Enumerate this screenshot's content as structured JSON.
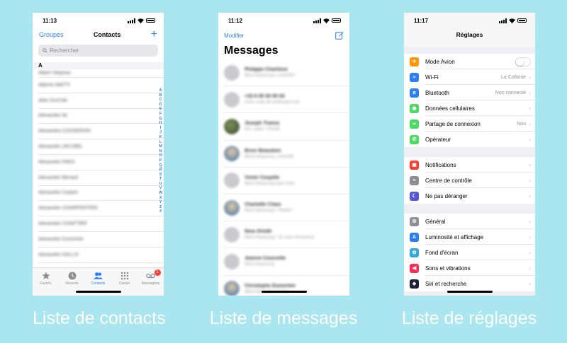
{
  "captions": [
    "Liste de contacts",
    "Liste de messages",
    "Liste de réglages"
  ],
  "contacts": {
    "time": "11:13",
    "groups": "Groupes",
    "title": "Contacts",
    "add": "+",
    "search_placeholder": "Rechercher",
    "section": "A",
    "rows": [
      "Albert Stephan",
      "Alberto MATTI",
      "Aldo DUCHA",
      "Alexandre Ali",
      "Alexandra COSSERON",
      "Alexandre JACOBS",
      "Alexandre FAES",
      "Alexandre Benard",
      "Alexandre Cadam",
      "Alexandre CHARPENTIER",
      "Alexandre CHAPTIER",
      "Alexandre Dumortier",
      "Alexandre GALLO"
    ],
    "index": [
      "A",
      "B",
      "C",
      "D",
      "E",
      "F",
      "G",
      "H",
      "I",
      "J",
      "K",
      "L",
      "M",
      "N",
      "O",
      "P",
      "Q",
      "R",
      "S",
      "T",
      "U",
      "V",
      "W",
      "X",
      "Y",
      "Z",
      "#"
    ],
    "tabs": [
      {
        "label": "Favoris",
        "icon": "star-icon"
      },
      {
        "label": "Récents",
        "icon": "clock-icon"
      },
      {
        "label": "Contacts",
        "icon": "contacts-icon"
      },
      {
        "label": "Clavier",
        "icon": "keypad-icon"
      },
      {
        "label": "Messagerie",
        "icon": "voicemail-icon"
      }
    ],
    "voicemail_badge": "1"
  },
  "messages": {
    "time": "11:12",
    "edit": "Modifier",
    "title": "Messages",
    "rows": [
      {
        "name": "Philippe Charlieux",
        "preview": "Merci beaucoup, à bientôt !"
      },
      {
        "name": "+33 6 00 00 00 00",
        "preview": "Votre code de vérification est"
      },
      {
        "name": "Joseph Tranca",
        "preview": "Oui, super ! Parfait"
      },
      {
        "name": "Brice Beaudoin",
        "preview": "Merci beaucoup, à bientôt"
      },
      {
        "name": "Victor Coujolle",
        "preview": "Merci beaucoup pour l'info"
      },
      {
        "name": "Charlotte Chaix",
        "preview": "Merci beaucoup ! Parfait !"
      },
      {
        "name": "Nina Orlotti",
        "preview": "Merci beaucoup ! Je vous recontacte"
      },
      {
        "name": "Jeanne Courcelle",
        "preview": "Merci beaucoup"
      },
      {
        "name": "Christophe Dumortier",
        "preview": "Merci beaucoup à vous"
      }
    ]
  },
  "settings": {
    "time": "11:17",
    "title": "Réglages",
    "groups": [
      [
        {
          "label": "Mode Avion",
          "color": "#ff9500",
          "icon": "airplane-icon",
          "glyph": "✈",
          "toggle": true
        },
        {
          "label": "Wi-Fi",
          "color": "#2b7ff2",
          "icon": "wifi-icon",
          "glyph": "≈",
          "value": "La Collonie"
        },
        {
          "label": "Bluetooth",
          "color": "#2b7ff2",
          "icon": "bluetooth-icon",
          "glyph": "ʙ",
          "value": "Non connecté"
        },
        {
          "label": "Données cellulaires",
          "color": "#4cd964",
          "icon": "cellular-icon",
          "glyph": "◉"
        },
        {
          "label": "Partage de connexion",
          "color": "#4cd964",
          "icon": "hotspot-icon",
          "glyph": "∞",
          "value": "Non"
        },
        {
          "label": "Opérateur",
          "color": "#4cd964",
          "icon": "phone-icon",
          "glyph": "✆"
        }
      ],
      [
        {
          "label": "Notifications",
          "color": "#ff3b30",
          "icon": "notifications-icon",
          "glyph": "▣"
        },
        {
          "label": "Centre de contrôle",
          "color": "#8e8e93",
          "icon": "control-center-icon",
          "glyph": "≡"
        },
        {
          "label": "Ne pas déranger",
          "color": "#5856d6",
          "icon": "moon-icon",
          "glyph": "☾"
        }
      ],
      [
        {
          "label": "Général",
          "color": "#8e8e93",
          "icon": "gear-icon",
          "glyph": "⚙"
        },
        {
          "label": "Luminosité et affichage",
          "color": "#2b7ff2",
          "icon": "display-icon",
          "glyph": "A"
        },
        {
          "label": "Fond d'écran",
          "color": "#34aadc",
          "icon": "wallpaper-icon",
          "glyph": "✿"
        },
        {
          "label": "Sons et vibrations",
          "color": "#ff2d55",
          "icon": "sound-icon",
          "glyph": "◀"
        },
        {
          "label": "Siri et recherche",
          "color": "#1f1f3a",
          "icon": "siri-icon",
          "glyph": "◈"
        }
      ]
    ]
  }
}
